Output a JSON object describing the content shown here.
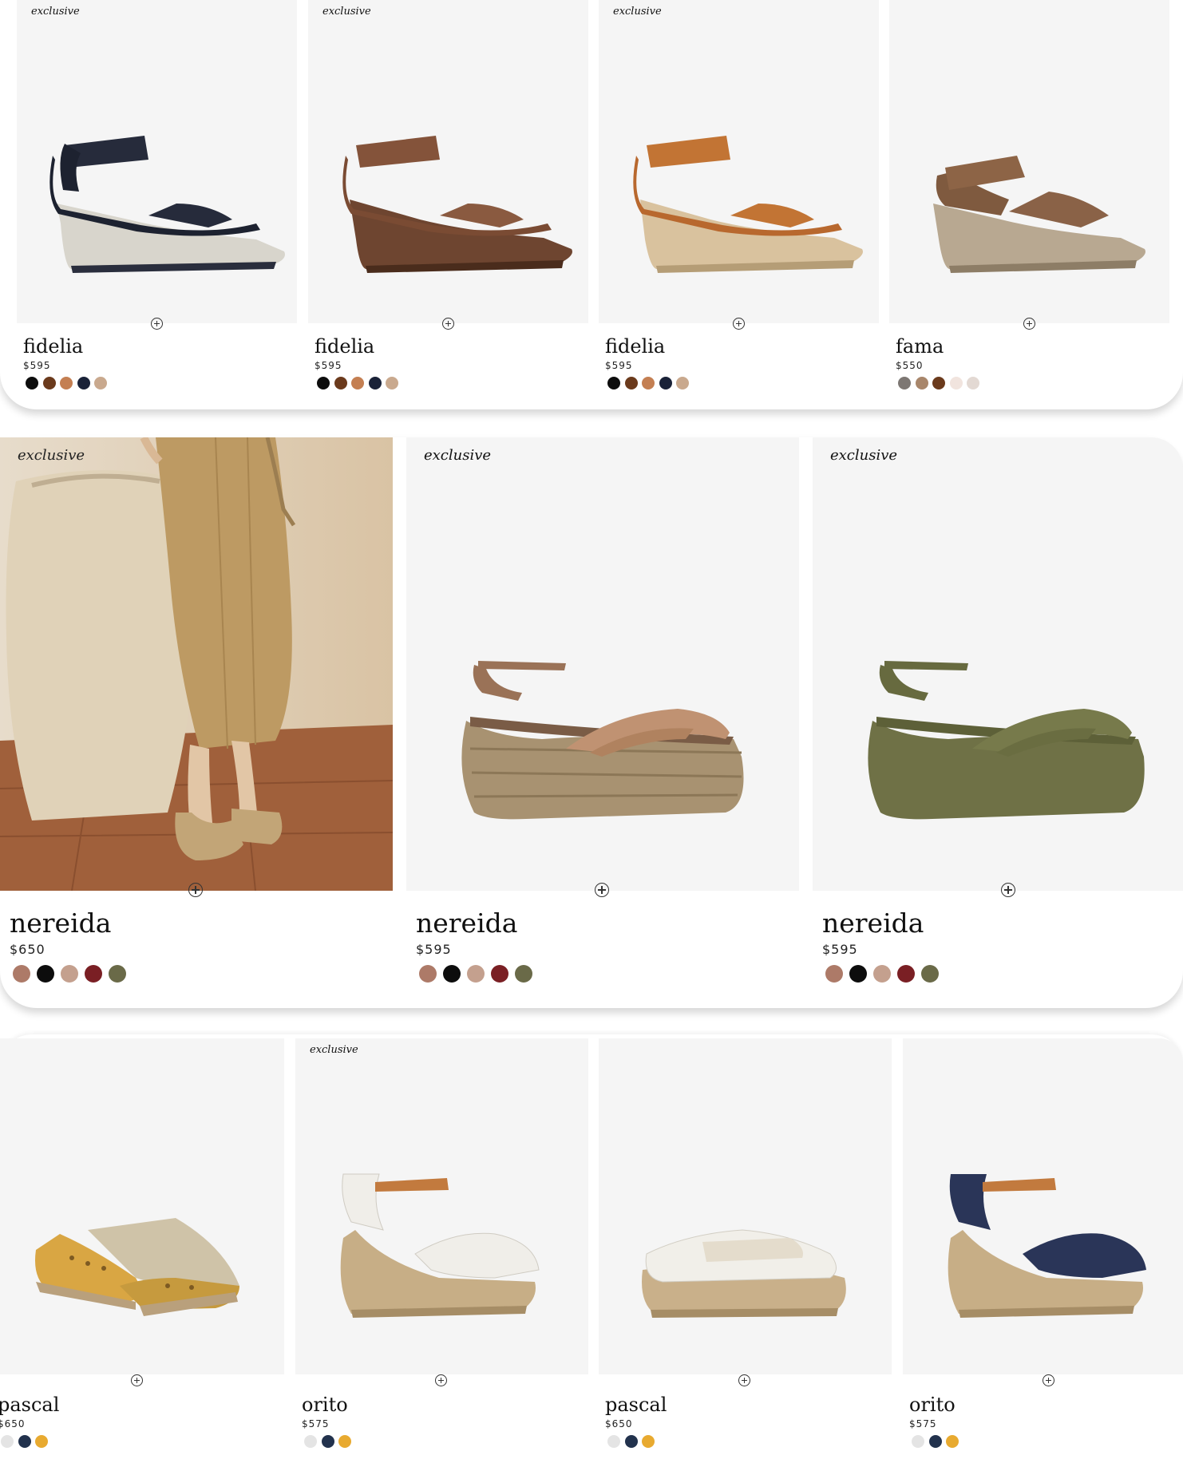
{
  "add_icon": "plus-circle-icon",
  "row1": [
    {
      "badge": "exclusive",
      "name": "fidelia",
      "price": "$595",
      "image": "black-leather-wedge-sandal",
      "swatches": [
        "#0d0d0d",
        "#6b3a1c",
        "#c47f52",
        "#1a2238",
        "#c9a98e"
      ]
    },
    {
      "badge": "exclusive",
      "name": "fidelia",
      "price": "$595",
      "image": "brown-leather-wedge-sandal",
      "swatches": [
        "#0d0d0d",
        "#6b3a1c",
        "#c47f52",
        "#1a2238",
        "#c9a98e"
      ]
    },
    {
      "badge": "exclusive",
      "name": "fidelia",
      "price": "$595",
      "image": "tan-espadrille-wedge-sandal",
      "swatches": [
        "#0d0d0d",
        "#6b3a1c",
        "#c47f52",
        "#1a2238",
        "#c9a98e"
      ]
    },
    {
      "badge": "",
      "name": "fama",
      "price": "$550",
      "image": "suede-woven-wedge-sandal",
      "swatches": [
        "#7d7773",
        "#a8866b",
        "#6b3a1c",
        "#f1e4de",
        "#e3d9d3"
      ]
    }
  ],
  "row2": [
    {
      "badge": "exclusive",
      "name": "nereida",
      "price": "$650",
      "image": "lifestyle-photo-woman-linen-skirt-terracotta-pot",
      "swatches": [
        "#ad7a68",
        "#0d0d0d",
        "#c4a08e",
        "#7a1f24",
        "#6a6a48"
      ]
    },
    {
      "badge": "exclusive",
      "name": "nereida",
      "price": "$595",
      "image": "tan-suede-jute-platform-sandal",
      "swatches": [
        "#ad7a68",
        "#0d0d0d",
        "#c4a08e",
        "#7a1f24",
        "#6a6a48"
      ]
    },
    {
      "badge": "exclusive",
      "name": "nereida",
      "price": "$595",
      "image": "olive-suede-platform-sandal",
      "swatches": [
        "#ad7a68",
        "#0d0d0d",
        "#c4a08e",
        "#7a1f24",
        "#6a6a48"
      ]
    }
  ],
  "row3": [
    {
      "badge": "",
      "name": "pascal",
      "price": "$650",
      "image": "yellow-perforated-lace-up-espadrille",
      "swatches": [
        "#e4e4e4",
        "#22324d",
        "#e8aa30"
      ]
    },
    {
      "badge": "exclusive",
      "name": "orito",
      "price": "$575",
      "image": "white-perforated-espadrille-wedge",
      "swatches": [
        "#e4e4e4",
        "#22324d",
        "#e8aa30"
      ]
    },
    {
      "badge": "",
      "name": "pascal",
      "price": "$650",
      "image": "white-perforated-lace-up-espadrille",
      "swatches": [
        "#e4e4e4",
        "#22324d",
        "#e8aa30"
      ]
    },
    {
      "badge": "",
      "name": "orito",
      "price": "$575",
      "image": "navy-perforated-espadrille-wedge",
      "swatches": [
        "#e4e4e4",
        "#22324d",
        "#e8aa30"
      ]
    }
  ]
}
